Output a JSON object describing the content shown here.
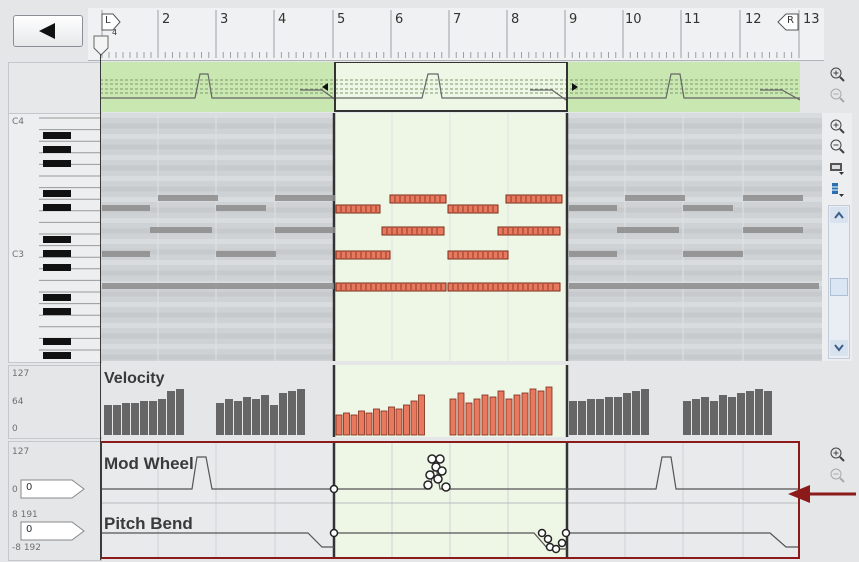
{
  "toolbar": {
    "back_icon": "left-arrow-icon"
  },
  "ruler": {
    "start_marker": "L",
    "start_sub": "4",
    "end_marker": "R",
    "bars": [
      "2",
      "3",
      "4",
      "5",
      "6",
      "7",
      "8",
      "9",
      "10",
      "11",
      "12",
      "13"
    ]
  },
  "piano": {
    "label_c4": "C4",
    "label_c3": "C3"
  },
  "velocity": {
    "title": "Velocity",
    "max": "127",
    "mid": "64",
    "min": "0"
  },
  "mod_wheel": {
    "title": "Mod Wheel",
    "max": "127",
    "min": "0",
    "value": "0"
  },
  "pitch_bend": {
    "title": "Pitch Bend",
    "max": "8 191",
    "min": "-8 192",
    "value": "0"
  },
  "colors": {
    "loop_region": "#eef6e6",
    "note_active": "#e8795f",
    "note_ghost": "#8c8c8c",
    "automation_border": "#8b1a1a",
    "overview_fill": "#c9e7b0"
  },
  "icons": [
    "zoom-in-icon",
    "zoom-out-icon",
    "tool-icon",
    "scroll-up-icon",
    "scroll-down-icon",
    "pointer-arrow-icon"
  ]
}
